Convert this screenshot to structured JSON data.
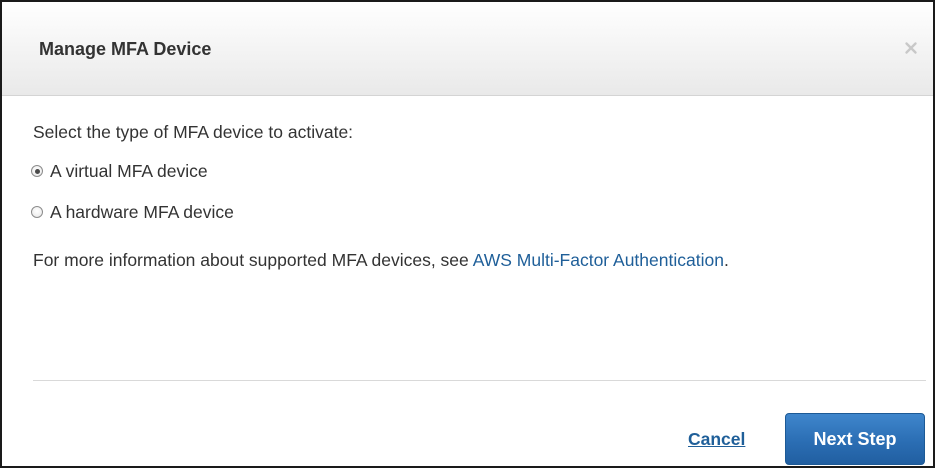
{
  "dialog": {
    "title": "Manage MFA Device",
    "close_icon": "close-icon"
  },
  "content": {
    "prompt": "Select the type of MFA device to activate:",
    "options": [
      {
        "label": "A virtual MFA device",
        "selected": true
      },
      {
        "label": "A hardware MFA device",
        "selected": false
      }
    ],
    "info_prefix": "For more information about supported MFA devices, see",
    "info_link": "AWS Multi-Factor Authentication",
    "info_suffix": "."
  },
  "footer": {
    "cancel_label": "Cancel",
    "next_label": "Next Step"
  },
  "colors": {
    "link": "#1f5f99",
    "primary_button": "#2b6eb4",
    "text": "#333333"
  }
}
